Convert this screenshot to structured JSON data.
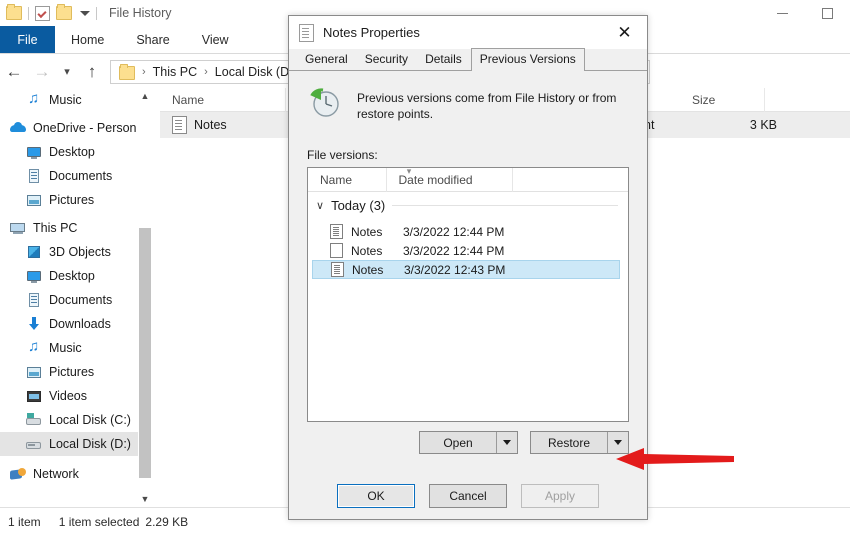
{
  "window": {
    "title": "File History",
    "quick_access": [
      "folder-icon",
      "properties-icon",
      "folder-icon",
      "dropdown-caret-icon"
    ],
    "controls": {
      "minimize": "minimize-icon",
      "maximize": "maximize-icon"
    },
    "ribbon_tabs": [
      {
        "label": "File",
        "active": true
      },
      {
        "label": "Home",
        "active": false
      },
      {
        "label": "Share",
        "active": false
      },
      {
        "label": "View",
        "active": false
      }
    ],
    "address": {
      "back": "back-arrow-icon",
      "forward": "forward-arrow-icon",
      "recent": "chevron-down-icon",
      "up": "up-arrow-icon",
      "crumbs": [
        "This PC",
        "Local Disk (D:)"
      ],
      "separator": "›"
    }
  },
  "nav_pane": {
    "items": [
      {
        "label": "Music",
        "icon": "music-icon",
        "indent": 1,
        "selected": false
      },
      {
        "label": "OneDrive - Person",
        "icon": "cloud-icon",
        "indent": 0,
        "selected": false
      },
      {
        "label": "Desktop",
        "icon": "desktop-icon",
        "indent": 1,
        "selected": false
      },
      {
        "label": "Documents",
        "icon": "documents-icon",
        "indent": 1,
        "selected": false
      },
      {
        "label": "Pictures",
        "icon": "pictures-icon",
        "indent": 1,
        "selected": false
      },
      {
        "label": "This PC",
        "icon": "this-pc-icon",
        "indent": 0,
        "selected": false
      },
      {
        "label": "3D Objects",
        "icon": "3d-objects-icon",
        "indent": 1,
        "selected": false
      },
      {
        "label": "Desktop",
        "icon": "desktop-icon",
        "indent": 1,
        "selected": false
      },
      {
        "label": "Documents",
        "icon": "documents-icon",
        "indent": 1,
        "selected": false
      },
      {
        "label": "Downloads",
        "icon": "downloads-icon",
        "indent": 1,
        "selected": false
      },
      {
        "label": "Music",
        "icon": "music-icon",
        "indent": 1,
        "selected": false
      },
      {
        "label": "Pictures",
        "icon": "pictures-icon",
        "indent": 1,
        "selected": false
      },
      {
        "label": "Videos",
        "icon": "videos-icon",
        "indent": 1,
        "selected": false
      },
      {
        "label": "Local Disk (C:)",
        "icon": "disk-c-icon",
        "indent": 1,
        "selected": false
      },
      {
        "label": "Local Disk (D:)",
        "icon": "disk-d-icon",
        "indent": 1,
        "selected": true
      },
      {
        "label": "Network",
        "icon": "network-icon",
        "indent": 0,
        "selected": false
      }
    ]
  },
  "file_list": {
    "columns": [
      "Name",
      "Size"
    ],
    "rows": [
      {
        "name": "Notes",
        "type_fragment": "nt",
        "size": "3 KB",
        "icon": "file-icon",
        "selected": true
      }
    ]
  },
  "status_bar": {
    "item_count": "1 item",
    "selection": "1 item selected",
    "size": "2.29 KB"
  },
  "dialog": {
    "title": "Notes Properties",
    "icon": "file-icon",
    "close": "✕",
    "tabs": [
      {
        "label": "General",
        "active": false
      },
      {
        "label": "Security",
        "active": false
      },
      {
        "label": "Details",
        "active": false
      },
      {
        "label": "Previous Versions",
        "active": true
      }
    ],
    "info_text": "Previous versions come from File History or from restore points.",
    "info_icon": "restore-clock-icon",
    "file_versions_label": "File versions:",
    "list": {
      "columns": [
        "Name",
        "Date modified"
      ],
      "group": {
        "chevron": "∨",
        "label": "Today (3)"
      },
      "rows": [
        {
          "name": "Notes",
          "date_modified": "3/3/2022 12:44 PM",
          "icon": "file-icon",
          "selected": false
        },
        {
          "name": "Notes",
          "date_modified": "3/3/2022 12:44 PM",
          "icon": "file-icon",
          "selected": false
        },
        {
          "name": "Notes",
          "date_modified": "3/3/2022 12:43 PM",
          "icon": "file-icon",
          "selected": true
        }
      ]
    },
    "action_buttons": [
      {
        "label": "Open",
        "name": "open-split-button"
      },
      {
        "label": "Restore",
        "name": "restore-split-button"
      }
    ],
    "footer_buttons": [
      {
        "label": "OK",
        "state": "default"
      },
      {
        "label": "Cancel",
        "state": "normal"
      },
      {
        "label": "Apply",
        "state": "disabled"
      }
    ]
  },
  "annotation": {
    "arrow_color": "#e31b1b",
    "points_to": "Restore"
  },
  "colors": {
    "ribbon_file_tab": "#0a5ba0",
    "selection_blue": "#cde8f7",
    "nav_selection_gray": "#e4e4e4",
    "dialog_bg": "#f0f0f0",
    "accent_arrow": "#e31b1b"
  }
}
